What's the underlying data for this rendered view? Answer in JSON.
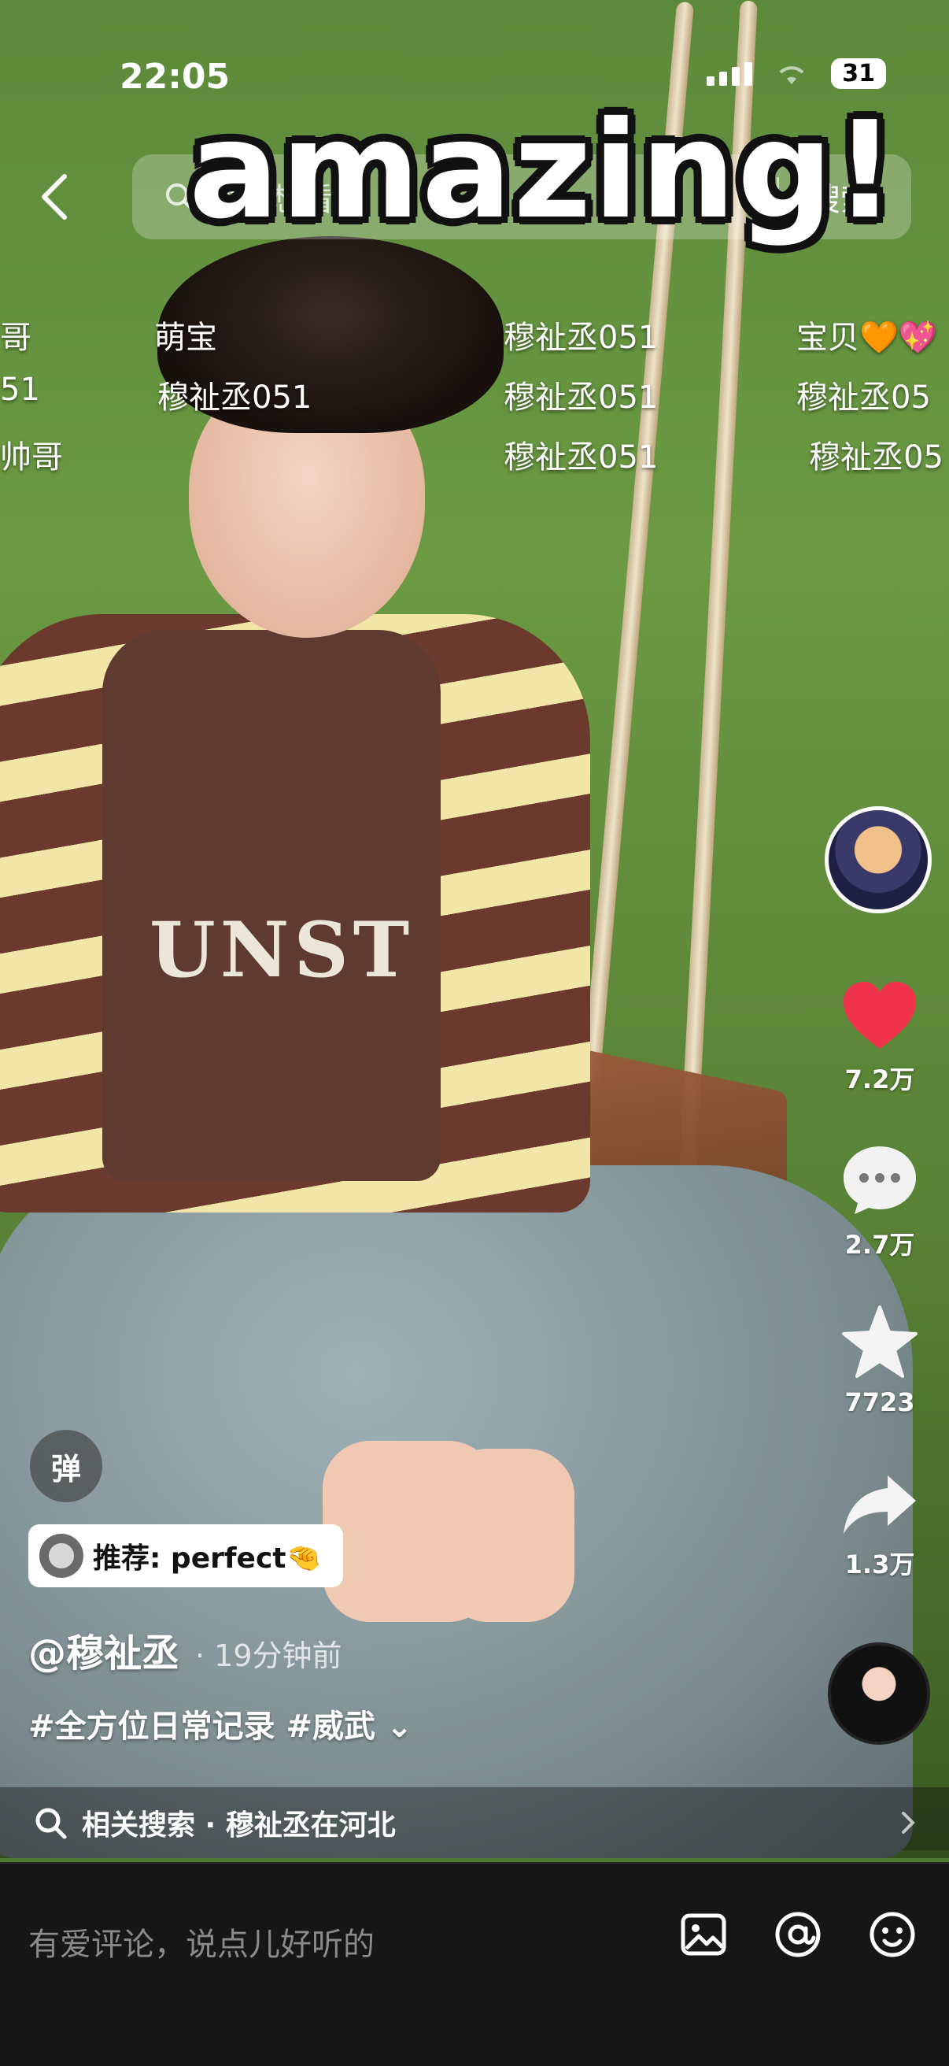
{
  "status_bar": {
    "time": "22:05",
    "battery": "31"
  },
  "search": {
    "placeholder": "搜你想看的",
    "button": "搜索"
  },
  "sticker_text": "amazing!",
  "danmaku": [
    {
      "text": "哥"
    },
    {
      "text": "萌宝"
    },
    {
      "text": "穆祉丞051"
    },
    {
      "text": "宝贝🧡💖"
    },
    {
      "text": "51"
    },
    {
      "text": "穆祉丞051"
    },
    {
      "text": "穆祉丞051"
    },
    {
      "text": "穆祉丞05"
    },
    {
      "text": "帅哥"
    },
    {
      "text": "穆祉丞051"
    },
    {
      "text": "穆祉丞05"
    }
  ],
  "rail": {
    "likes": "7.2万",
    "comments": "2.7万",
    "favorites": "7723",
    "shares": "1.3万"
  },
  "danmaku_toggle": "弹",
  "recommend_tag": "推荐: perfect🤏",
  "author": "@穆祉丞",
  "time_ago": "· 19分钟前",
  "caption": "#全方位日常记录 #威武 ⌄",
  "related_search": "相关搜索 · 穆祉丞在河北",
  "comment_placeholder": "有爱评论，说点儿好听的",
  "colors": {
    "like": "#f0334a",
    "comment_bar": "#161616"
  },
  "icons": [
    "back-icon",
    "search-icon",
    "heart-icon",
    "comment-icon",
    "star-icon",
    "share-icon",
    "image-icon",
    "at-icon",
    "emoji-icon"
  ]
}
